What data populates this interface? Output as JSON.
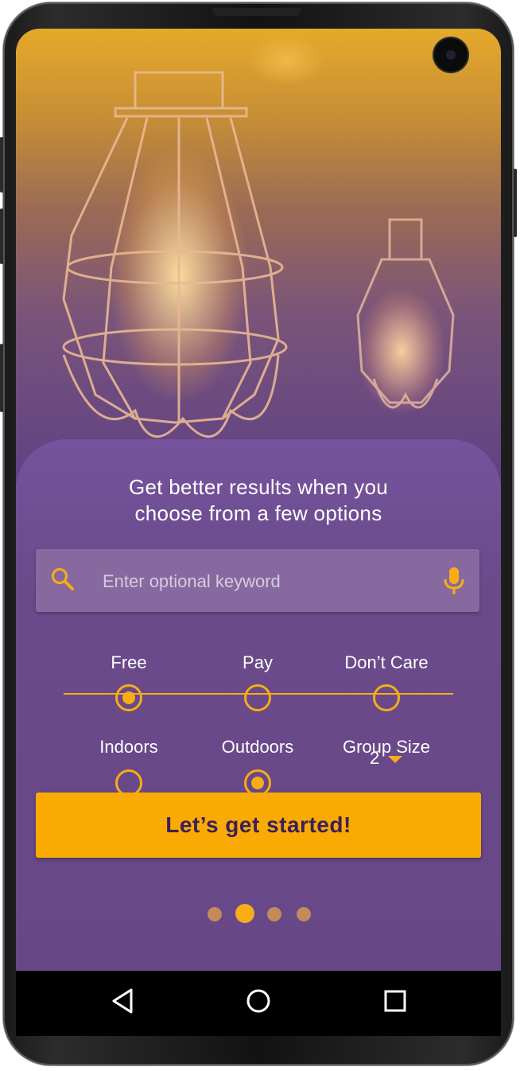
{
  "headline": {
    "line1": "Get better results when you",
    "line2": "choose from a few options"
  },
  "search": {
    "placeholder": "Enter optional keyword",
    "icon": "search-icon",
    "mic_icon": "microphone-icon"
  },
  "cost_options": [
    {
      "label": "Free",
      "selected": true
    },
    {
      "label": "Pay",
      "selected": false
    },
    {
      "label": "Don’t Care",
      "selected": false
    }
  ],
  "location_options": [
    {
      "label": "Indoors",
      "selected": false
    },
    {
      "label": "Outdoors",
      "selected": true
    }
  ],
  "group_size": {
    "label": "Group Size",
    "value": "2"
  },
  "cta": {
    "label": "Let’s get started!"
  },
  "pager": {
    "count": 4,
    "active_index": 1
  },
  "colors": {
    "accent": "#f6ad16",
    "sheet": "#684787",
    "cta_text": "#3c1f5a"
  },
  "navbar": {
    "back_icon": "back-triangle-icon",
    "home_icon": "home-circle-icon",
    "recents_icon": "recents-square-icon"
  }
}
